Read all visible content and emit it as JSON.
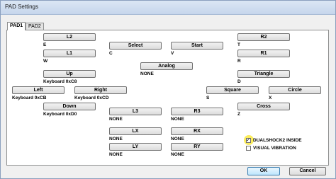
{
  "window": {
    "title": "PAD Settings"
  },
  "tabs": [
    {
      "label": "PAD1",
      "active": true
    },
    {
      "label": "PAD2",
      "active": false
    }
  ],
  "mappings": {
    "l2": {
      "label": "L2",
      "value": "E"
    },
    "l1": {
      "label": "L1",
      "value": "W"
    },
    "select": {
      "label": "Select",
      "value": "C"
    },
    "start": {
      "label": "Start",
      "value": "V"
    },
    "r2": {
      "label": "R2",
      "value": "T"
    },
    "r1": {
      "label": "R1",
      "value": "R"
    },
    "analog": {
      "label": "Analog",
      "value": "NONE"
    },
    "up": {
      "label": "Up",
      "value": "Keyboard 0xC8"
    },
    "triangle": {
      "label": "Triangle",
      "value": "D"
    },
    "left": {
      "label": "Left",
      "value": "Keyboard 0xCB"
    },
    "right": {
      "label": "Right",
      "value": "Keyboard 0xCD"
    },
    "square": {
      "label": "Square",
      "value": "S"
    },
    "circle": {
      "label": "Circle",
      "value": "X"
    },
    "down": {
      "label": "Down",
      "value": "Keyboard 0xD0"
    },
    "cross": {
      "label": "Cross",
      "value": "Z"
    },
    "l3": {
      "label": "L3",
      "value": "NONE"
    },
    "r3": {
      "label": "R3",
      "value": "NONE"
    },
    "lx": {
      "label": "LX",
      "value": "NONE"
    },
    "rx": {
      "label": "RX",
      "value": "NONE"
    },
    "ly": {
      "label": "LY",
      "value": "NONE"
    },
    "ry": {
      "label": "RY",
      "value": "NONE"
    }
  },
  "options": {
    "dualshock2": {
      "label": "DUALSHOCK2 INSIDE",
      "checked": true
    },
    "vibration": {
      "label": "VISUAL VIBRATION",
      "checked": false
    }
  },
  "footer": {
    "ok_label": "OK",
    "cancel_label": "Cancel"
  }
}
